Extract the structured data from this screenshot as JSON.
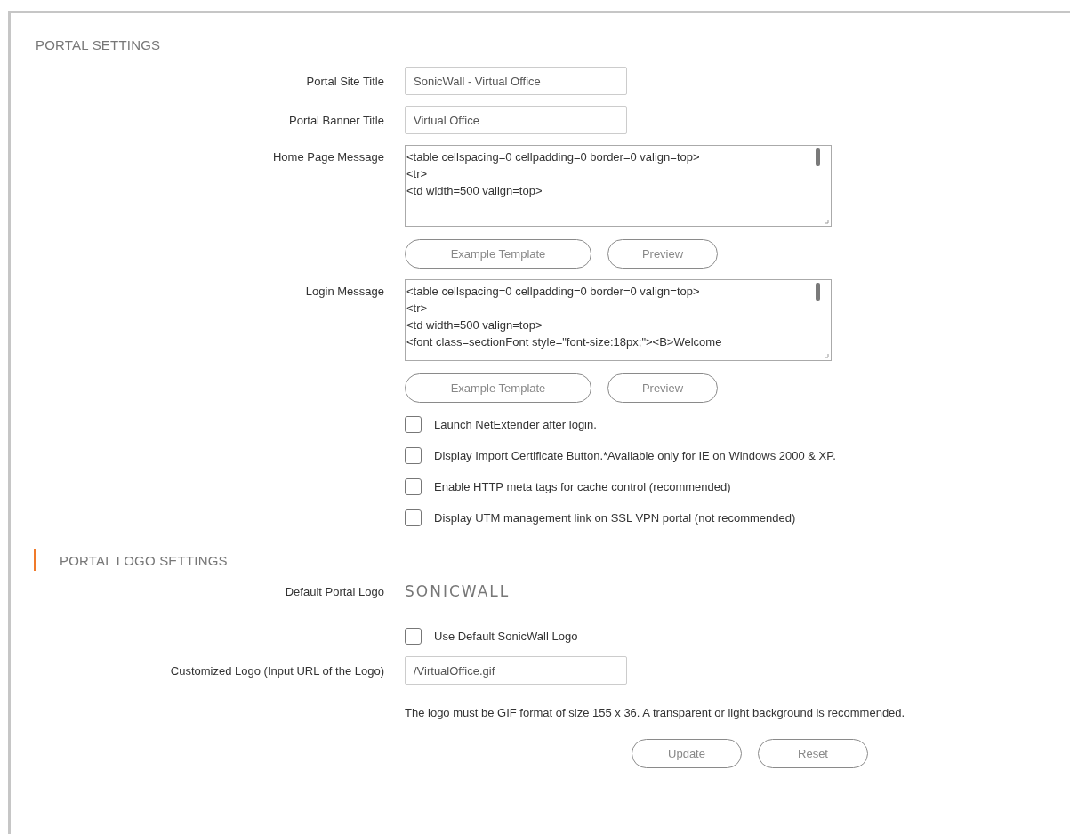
{
  "sections": [
    {
      "title": "PORTAL SETTINGS",
      "active": false,
      "rows": [
        {
          "kind": "input",
          "label": "Portal Site Title",
          "value": "SonicWall - Virtual Office"
        },
        {
          "kind": "input",
          "label": "Portal Banner Title",
          "value": "Virtual Office"
        },
        {
          "kind": "message",
          "label": "Home Page Message",
          "value": "<table cellspacing=0 cellpadding=0 border=0 valign=top>\n<tr>\n<td width=500 valign=top>",
          "buttons": [
            "Example Template",
            "Preview"
          ]
        },
        {
          "kind": "message",
          "label": "Login Message",
          "value": "<table cellspacing=0 cellpadding=0 border=0 valign=top>\n<tr>\n<td width=500 valign=top>\n<font class=sectionFont style=\"font-size:18px;\"><B>Welcome",
          "buttons": [
            "Example Template",
            "Preview"
          ]
        },
        {
          "kind": "checkbox",
          "label": "Launch NetExtender after login.",
          "checked": false
        },
        {
          "kind": "checkbox",
          "label": "Display Import Certificate Button.*Available only for IE on Windows 2000 & XP.",
          "checked": false
        },
        {
          "kind": "checkbox",
          "label": "Enable HTTP meta tags for cache control (recommended)",
          "checked": false
        },
        {
          "kind": "checkbox",
          "label": "Display UTM management link on SSL VPN portal (not recommended)",
          "checked": false
        }
      ]
    },
    {
      "title": "PORTAL LOGO SETTINGS",
      "active": true,
      "rows": [
        {
          "kind": "logo",
          "label": "Default Portal Logo",
          "logo": "SONICWALL"
        },
        {
          "kind": "checkbox",
          "label": "Use Default SonicWall Logo",
          "checked": false
        },
        {
          "kind": "input",
          "label": "Customized Logo (Input URL of the Logo)",
          "value": "/VirtualOffice.gif"
        },
        {
          "kind": "note",
          "text": "The logo must be GIF format of size 155 x 36. A transparent or light background is recommended."
        }
      ]
    }
  ],
  "footer_buttons": [
    "Update",
    "Reset"
  ]
}
